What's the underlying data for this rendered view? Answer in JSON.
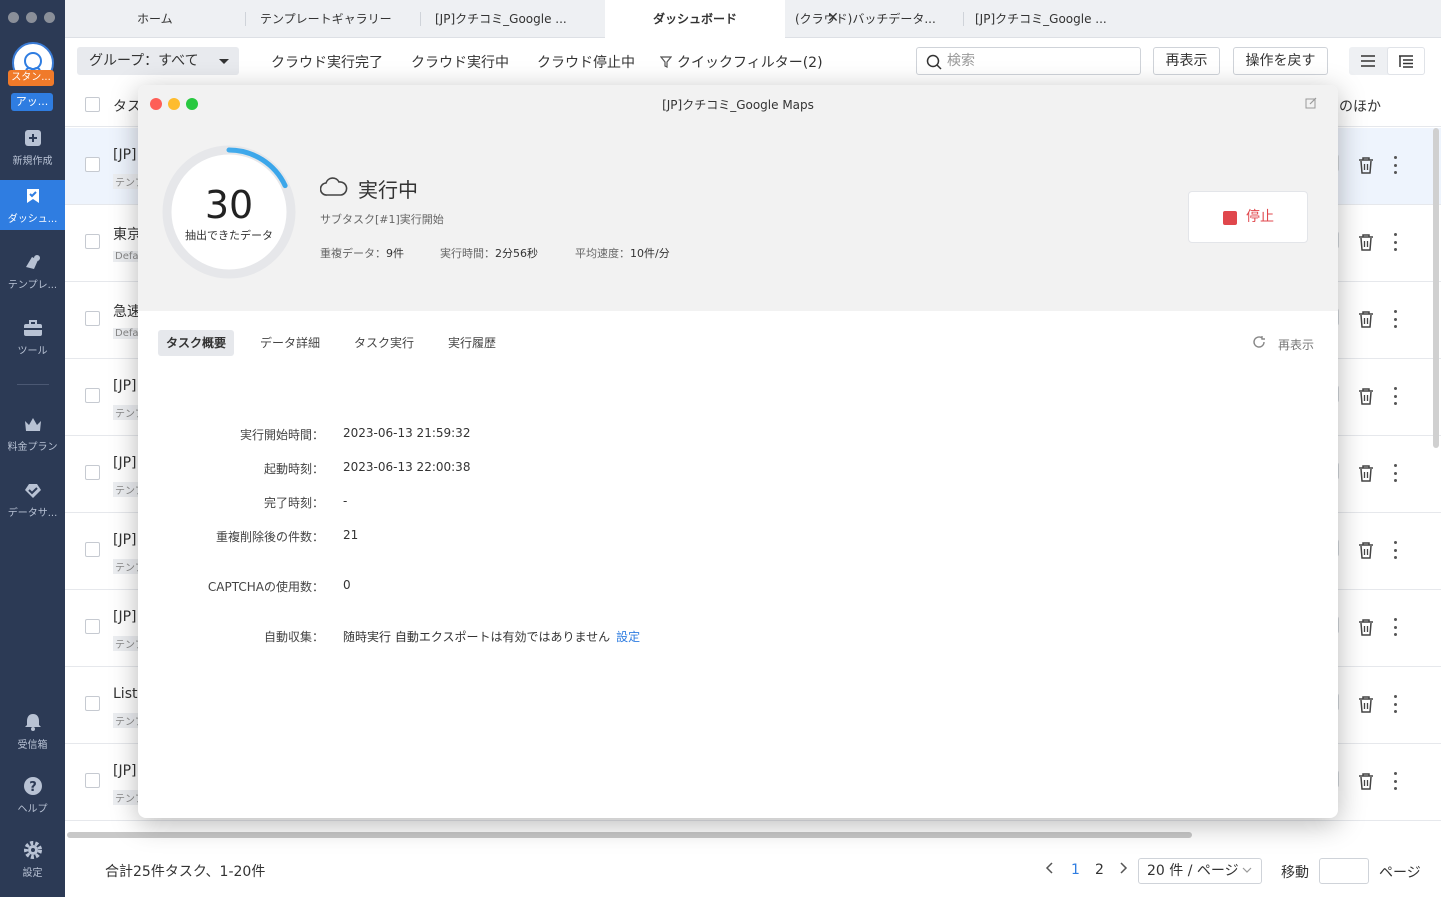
{
  "sidebar": {
    "plan_badge": "スタン...",
    "account_badge": "アッ...",
    "items": [
      {
        "label": "新規作成",
        "icon": "plus-icon"
      },
      {
        "label": "ダッシュ...",
        "icon": "dashboard-icon"
      },
      {
        "label": "テンプレ...",
        "icon": "template-icon"
      },
      {
        "label": "ツール",
        "icon": "toolbox-icon"
      },
      {
        "label": "料金プラン",
        "icon": "crown-icon"
      },
      {
        "label": "データサ...",
        "icon": "data-service-icon"
      },
      {
        "label": "受信箱",
        "icon": "bell-icon"
      },
      {
        "label": "ヘルプ",
        "icon": "help-icon"
      },
      {
        "label": "設定",
        "icon": "gear-icon"
      }
    ]
  },
  "tabs": [
    {
      "label": "ホーム"
    },
    {
      "label": "テンプレートギャラリー"
    },
    {
      "label": "[JP]クチコミ_Google ..."
    },
    {
      "label": "ダッシュボード"
    },
    {
      "label": "(クラウド)バッチデータ..."
    },
    {
      "label": "[JP]クチコミ_Google ..."
    }
  ],
  "toolbar": {
    "group_select": "グループ：すべて",
    "filters": [
      "クラウド実行完了",
      "クラウド実行中",
      "クラウド停止中"
    ],
    "quick_filter": "クイックフィルター(2)",
    "search_placeholder": "検索",
    "refresh_label": "再表示",
    "undo_label": "操作を戻す"
  },
  "table": {
    "header_task": "タス",
    "header_other": "のほか",
    "rows": [
      {
        "title": "[JP]",
        "sub": "テンプ"
      },
      {
        "title": "東京",
        "sub": "Defa"
      },
      {
        "title": "急速",
        "sub": "Defa"
      },
      {
        "title": "[JP]",
        "sub": "テンプ"
      },
      {
        "title": "[JP]",
        "sub": "テンプ"
      },
      {
        "title": "[JP]",
        "sub": "テンプ"
      },
      {
        "title": "[JP]",
        "sub": "テンプ"
      },
      {
        "title": "Listi",
        "sub": "テンプ"
      },
      {
        "title": "[JP]",
        "sub": "テンプ"
      }
    ]
  },
  "footer": {
    "total": "合計25件タスク、1-20件",
    "pages": [
      "1",
      "2"
    ],
    "current_page": "1",
    "per_page": "20 件 / ページ",
    "jump_label": "移動",
    "page_suffix": "ページ"
  },
  "modal": {
    "title": "[JP]クチコミ_Google Maps",
    "extracted_count": "30",
    "extracted_label": "抽出できたデータ",
    "progress_fraction": 0.18,
    "status": "実行中",
    "substatus": "サブタスク[#1]実行開始",
    "stats": [
      {
        "label": "重複データ：",
        "value": "9件"
      },
      {
        "label": "実行時間：",
        "value": "2分56秒"
      },
      {
        "label": "平均速度：",
        "value": "10件/分"
      }
    ],
    "stop_label": "停止",
    "tabs": [
      "タスク概要",
      "データ詳細",
      "タスク実行",
      "実行履歴"
    ],
    "refresh_label": "再表示",
    "fields": [
      {
        "label": "実行開始時間：",
        "value": "2023-06-13 21:59:32"
      },
      {
        "label": "起動時刻：",
        "value": "2023-06-13 22:00:38"
      },
      {
        "label": "完了時刻：",
        "value": "-"
      },
      {
        "label": "重複削除後の件数：",
        "value": "21"
      },
      {
        "label": "CAPTCHAの使用数：",
        "value": "0"
      },
      {
        "label": "自動収集：",
        "value": "随時実行  自動エクスポートは有効ではありません",
        "link": "設定"
      }
    ]
  },
  "colors": {
    "sidebar_bg": "#2c3a55",
    "accent": "#2f7de1",
    "stop_red": "#e0474c",
    "ring_start": "#7fd3f7",
    "ring_end": "#2f9ee8"
  }
}
